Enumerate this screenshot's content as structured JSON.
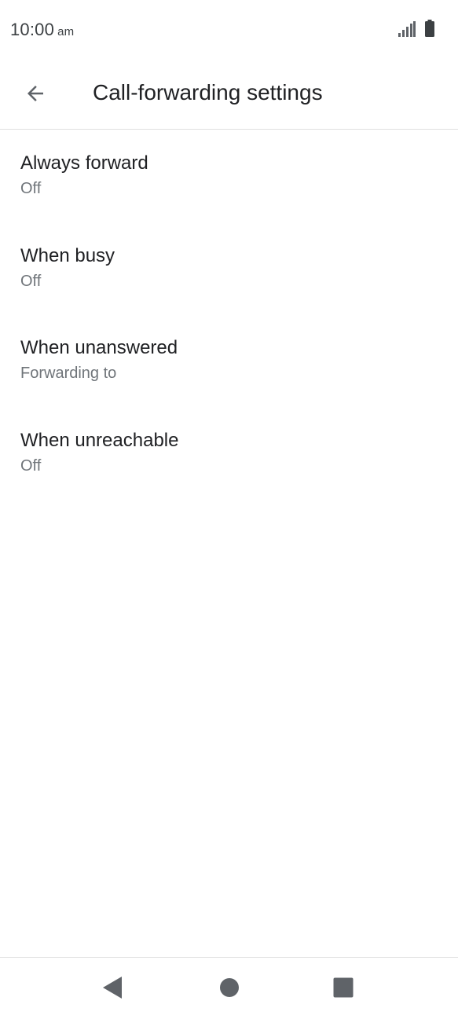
{
  "status_bar": {
    "time": "10:00",
    "ampm": "am",
    "icons": [
      "signal-icon",
      "battery-icon"
    ]
  },
  "app_bar": {
    "back_icon": "arrow-back-icon",
    "title": "Call-forwarding settings"
  },
  "settings": {
    "items": [
      {
        "title": "Always forward",
        "summary": "Off"
      },
      {
        "title": "When busy",
        "summary": "Off"
      },
      {
        "title": "When unanswered",
        "summary": "Forwarding to"
      },
      {
        "title": "When unreachable",
        "summary": "Off"
      }
    ]
  },
  "nav_bar": {
    "icons": [
      "nav-back-icon",
      "nav-home-icon",
      "nav-recents-icon"
    ]
  },
  "colors": {
    "icon": "#5f6368",
    "text_primary": "#202124",
    "text_secondary": "#70757a",
    "divider": "#e0e0e0"
  }
}
